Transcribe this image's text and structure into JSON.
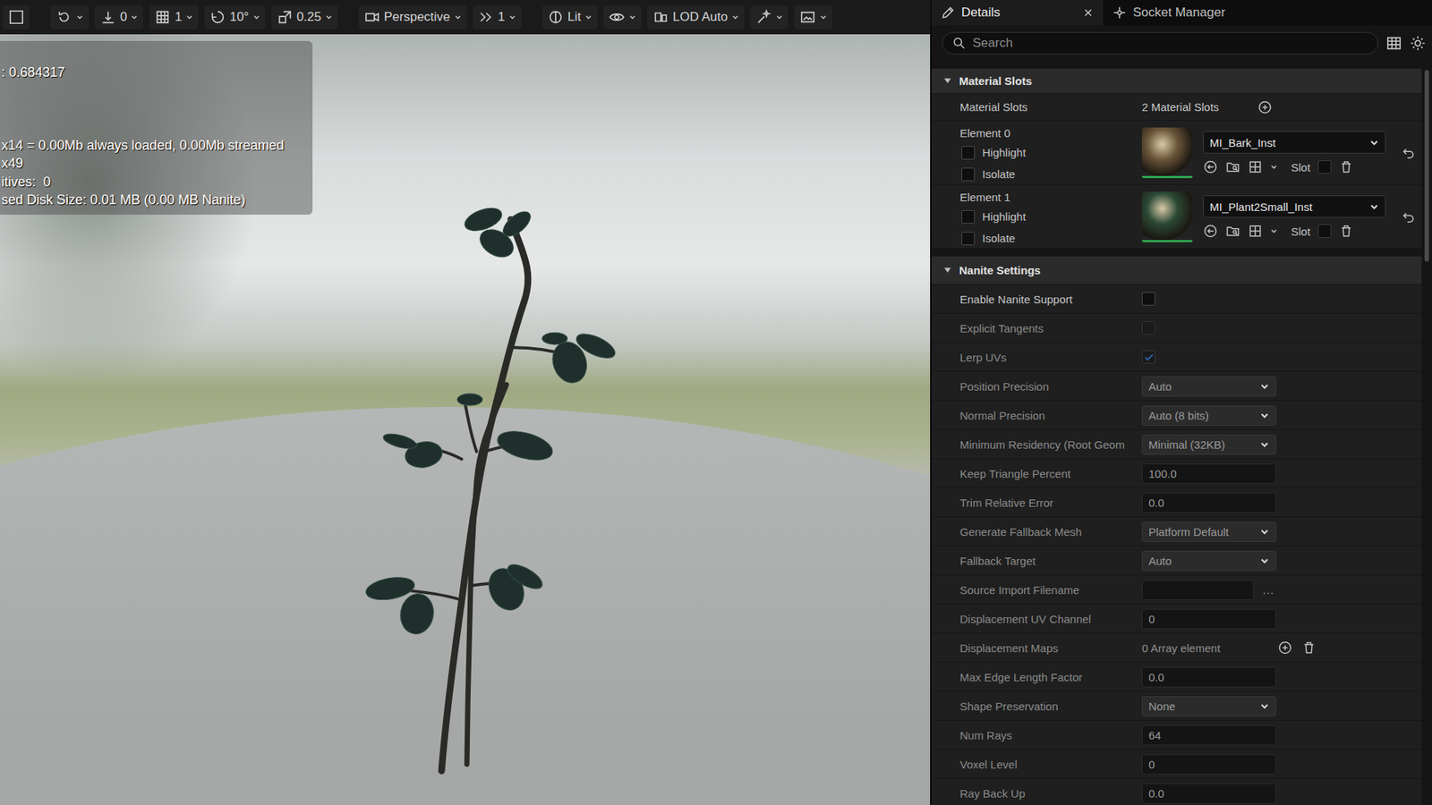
{
  "viewport": {
    "toolbar": [
      {
        "label": "",
        "caret": false
      },
      {
        "label": "",
        "caret": true
      },
      {
        "label": "0",
        "caret": true
      },
      {
        "label": "1",
        "caret": true
      },
      {
        "label": "10°",
        "caret": true
      },
      {
        "label": "0.25",
        "caret": true
      },
      {
        "label": "Perspective",
        "caret": true
      },
      {
        "label": "1",
        "caret": true
      },
      {
        "label": "Lit",
        "caret": true
      },
      {
        "label": "",
        "caret": true
      },
      {
        "label": "LOD Auto",
        "caret": true
      },
      {
        "label": "",
        "caret": true
      },
      {
        "label": "",
        "caret": true
      }
    ],
    "stats": [
      ": 0.684317",
      "x14 = 0.00Mb always loaded, 0.00Mb streamed",
      "x49",
      "itives:  0",
      "sed Disk Size: 0.01 MB (0.00 MB Nanite)"
    ]
  },
  "tabs": [
    {
      "label": "Details",
      "selected": true,
      "closable": true
    },
    {
      "label": "Socket Manager",
      "selected": false,
      "closable": false
    }
  ],
  "search": {
    "placeholder": "Search"
  },
  "material_slots": {
    "title": "Material Slots",
    "expanded": true,
    "count_label": "Material Slots",
    "count": "2 Material Slots",
    "elements": [
      {
        "label": "Element 0",
        "material": "MI_Bark_Inst",
        "color": "#6b563a",
        "highlight": {
          "label": "Highlight",
          "checked": false
        },
        "isolate": {
          "label": "Isolate",
          "checked": false
        },
        "slot_label": "Slot",
        "modified": true
      },
      {
        "label": "Element 1",
        "material": "MI_Plant2Small_Inst",
        "color": "#2c4a36",
        "highlight": {
          "label": "Highlight",
          "checked": false
        },
        "isolate": {
          "label": "Isolate",
          "checked": false
        },
        "slot_label": "Slot",
        "modified": true
      }
    ]
  },
  "nanite": {
    "title": "Nanite Settings",
    "expanded": true,
    "rows": [
      {
        "kind": "checkbox",
        "label": "Enable Nanite Support",
        "checked": false,
        "disabled": false
      },
      {
        "kind": "checkbox",
        "label": "Explicit Tangents",
        "checked": false,
        "disabled": true
      },
      {
        "kind": "checkbox",
        "label": "Lerp UVs",
        "checked": true,
        "disabled": true
      },
      {
        "kind": "dropdown",
        "label": "Position Precision",
        "value": "Auto",
        "disabled": true
      },
      {
        "kind": "dropdown",
        "label": "Normal Precision",
        "value": "Auto (8 bits)",
        "disabled": true
      },
      {
        "kind": "dropdown",
        "label": "Minimum Residency (Root Geom",
        "value": "Minimal (32KB)",
        "disabled": true
      },
      {
        "kind": "number",
        "label": "Keep Triangle Percent",
        "value": "100.0",
        "disabled": true
      },
      {
        "kind": "number",
        "label": "Trim Relative Error",
        "value": "0.0",
        "disabled": true
      },
      {
        "kind": "dropdown",
        "label": "Generate Fallback Mesh",
        "value": "Platform Default",
        "disabled": true
      },
      {
        "kind": "dropdown",
        "label": "Fallback Target",
        "value": "Auto",
        "disabled": true
      },
      {
        "kind": "file",
        "label": "Source Import Filename",
        "value": "",
        "button": "...",
        "disabled": true
      },
      {
        "kind": "number",
        "label": "Displacement UV Channel",
        "value": "0",
        "disabled": true
      },
      {
        "kind": "array",
        "label": "Displacement Maps",
        "value": "0 Array element",
        "disabled": true
      },
      {
        "kind": "number",
        "label": "Max Edge Length Factor",
        "value": "0.0",
        "disabled": true
      },
      {
        "kind": "dropdown",
        "label": "Shape Preservation",
        "value": "None",
        "disabled": true
      },
      {
        "kind": "number",
        "label": "Num Rays",
        "value": "64",
        "disabled": true
      },
      {
        "kind": "number",
        "label": "Voxel Level",
        "value": "0",
        "disabled": true
      },
      {
        "kind": "number",
        "label": "Ray Back Up",
        "value": "0.0",
        "disabled": true
      }
    ]
  }
}
